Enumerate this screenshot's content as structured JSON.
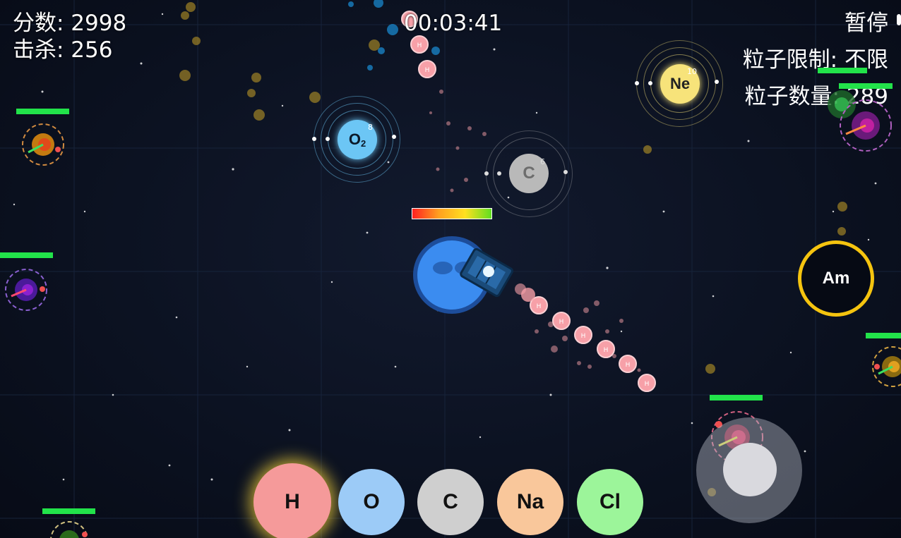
{
  "hud": {
    "score_label": "分数: 2998",
    "kills_label": "击杀: 256",
    "timer": "00:03:41",
    "pause_label": "暂停",
    "particle_limit_label": "粒子限制:",
    "particle_limit_value": "不限",
    "particle_count_label": "粒子数量:",
    "particle_count_value": "289"
  },
  "atoms": {
    "oxygen": {
      "symbol": "O",
      "subscript": "2",
      "number": "8",
      "color": "#6cc6f5"
    },
    "carbon": {
      "symbol": "C",
      "number": "6",
      "color": "#b9b9b9"
    },
    "neon": {
      "symbol": "Ne",
      "number": "10",
      "color": "#f7e37a"
    },
    "americium": {
      "symbol": "Am",
      "ring_color": "#f5c40f"
    }
  },
  "player": {
    "health_fraction": 1.0,
    "color": "#3b8cf0"
  },
  "element_buttons": [
    {
      "label": "H",
      "color": "#f59a9a"
    },
    {
      "label": "O",
      "color": "#9ccbf7"
    },
    {
      "label": "C",
      "color": "#cfcfcf"
    },
    {
      "label": "Na",
      "color": "#f9c79b"
    },
    {
      "label": "Cl",
      "color": "#9cf59a"
    }
  ],
  "colors": {
    "health_bar": "#22e34a",
    "projectile": "#f7a0a8",
    "grid": "#1a2740"
  }
}
